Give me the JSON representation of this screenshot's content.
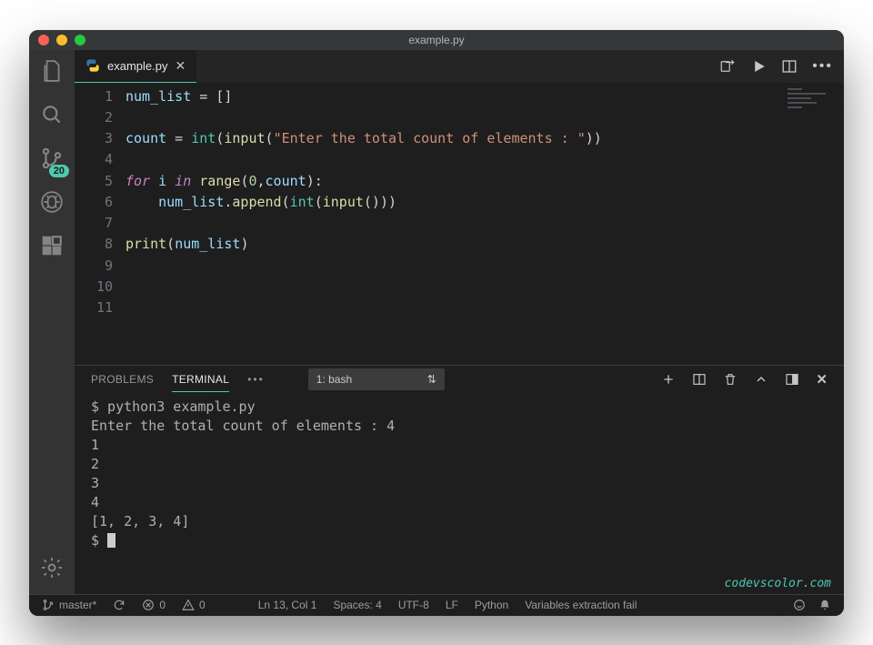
{
  "window": {
    "title": "example.py"
  },
  "activity": {
    "sourceControlBadge": "20"
  },
  "tabs": {
    "active": {
      "filename": "example.py"
    }
  },
  "code": {
    "lineCount": 11,
    "lines": [
      [
        [
          "var",
          "num_list"
        ],
        [
          "pl",
          " = []"
        ]
      ],
      [],
      [
        [
          "var",
          "count"
        ],
        [
          "pl",
          " = "
        ],
        [
          "bi",
          "int"
        ],
        [
          "pl",
          "("
        ],
        [
          "fn",
          "input"
        ],
        [
          "pl",
          "("
        ],
        [
          "str",
          "\"Enter the total count of elements : \""
        ],
        [
          "pl",
          "))"
        ]
      ],
      [],
      [
        [
          "kw",
          "for"
        ],
        [
          "pl",
          " "
        ],
        [
          "var",
          "i"
        ],
        [
          "pl",
          " "
        ],
        [
          "kw",
          "in"
        ],
        [
          "pl",
          " "
        ],
        [
          "fn",
          "range"
        ],
        [
          "pl",
          "("
        ],
        [
          "num",
          "0"
        ],
        [
          "pl",
          ","
        ],
        [
          "var",
          "count"
        ],
        [
          "pl",
          "):"
        ]
      ],
      [
        [
          "pl",
          "    "
        ],
        [
          "var",
          "num_list"
        ],
        [
          "pl",
          "."
        ],
        [
          "fn",
          "append"
        ],
        [
          "pl",
          "("
        ],
        [
          "bi",
          "int"
        ],
        [
          "pl",
          "("
        ],
        [
          "fn",
          "input"
        ],
        [
          "pl",
          "()))"
        ]
      ],
      [],
      [
        [
          "fn",
          "print"
        ],
        [
          "pl",
          "("
        ],
        [
          "var",
          "num_list"
        ],
        [
          "pl",
          ")"
        ]
      ],
      [],
      [],
      []
    ]
  },
  "panel": {
    "tabs": {
      "problems": "PROBLEMS",
      "terminal": "TERMINAL"
    },
    "more": "•••",
    "terminalSelector": "1: bash",
    "output": "$ python3 example.py\nEnter the total count of elements : 4\n1\n2\n3\n4\n[1, 2, 3, 4]\n$ "
  },
  "watermark": "codevscolor.com",
  "status": {
    "branch": "master*",
    "errors": "0",
    "warnings": "0",
    "cursor": "Ln 13, Col 1",
    "spaces": "Spaces: 4",
    "encoding": "UTF-8",
    "eol": "LF",
    "lang": "Python",
    "ext": "Variables extraction fail"
  }
}
